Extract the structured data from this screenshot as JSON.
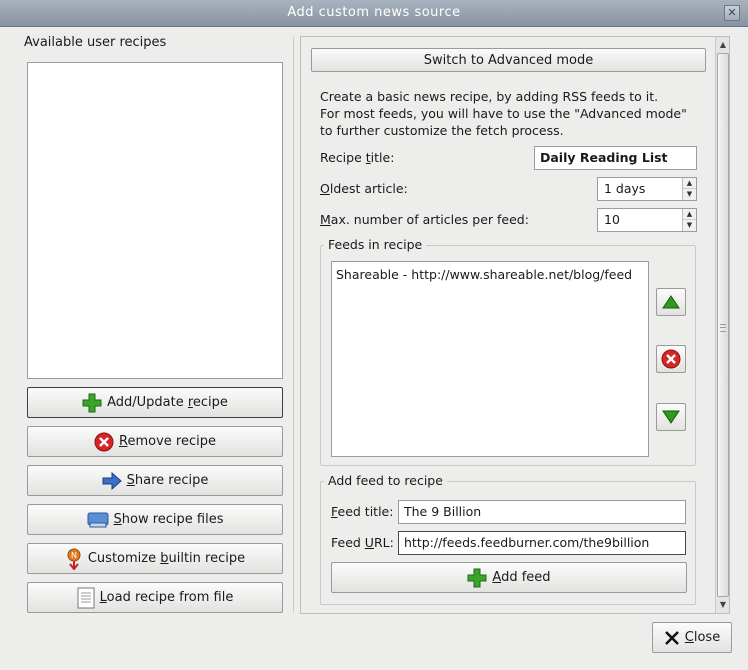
{
  "window": {
    "title": "Add custom news source",
    "close_glyph": "✕"
  },
  "left": {
    "group_label": "Available user recipes",
    "buttons": [
      {
        "icon": "plus-icon",
        "pre": "Add/Update ",
        "ul": "r",
        "post": "ecipe"
      },
      {
        "icon": "remove-icon",
        "pre": "",
        "ul": "R",
        "post": "emove recipe"
      },
      {
        "icon": "arrow-right-icon",
        "pre": "",
        "ul": "S",
        "post": "hare recipe"
      },
      {
        "icon": "folder-icon",
        "pre": "",
        "ul": "S",
        "post": "how recipe files"
      },
      {
        "icon": "customize-icon",
        "pre": "Customize ",
        "ul": "b",
        "post": "uiltin recipe"
      },
      {
        "icon": "document-icon",
        "pre": "",
        "ul": "L",
        "post": "oad recipe from file"
      }
    ]
  },
  "right": {
    "advanced_button": "Switch to Advanced mode",
    "info_lines": [
      "Create a basic news recipe, by adding RSS feeds to it.",
      "For most feeds, you will have to use the \"Advanced mode\"",
      "to further customize the fetch process."
    ],
    "recipe_title_label_pre": "Recipe ",
    "recipe_title_label_ul": "t",
    "recipe_title_label_post": "itle:",
    "recipe_title_value": "Daily Reading List",
    "oldest_label_ul": "O",
    "oldest_label_post": "ldest article:",
    "oldest_value": "1 days",
    "max_label_ul": "M",
    "max_label_post": "ax. number of articles per feed:",
    "max_value": "10",
    "feeds_group_label": "Feeds in recipe",
    "feeds": [
      "Shareable - http://www.shareable.net/blog/feed"
    ],
    "add_group_label": "Add feed to recipe",
    "feed_title_label_ul": "F",
    "feed_title_label_post": "eed title:",
    "feed_title_value": "The 9 Billion",
    "feed_url_label_pre": "Feed ",
    "feed_url_label_ul": "U",
    "feed_url_label_post": "RL:",
    "feed_url_value": "http://feeds.feedburner.com/the9billion",
    "add_feed_ul": "A",
    "add_feed_post": "dd feed"
  },
  "footer": {
    "close_ul": "C",
    "close_post": "lose"
  },
  "colors": {
    "green": "#2f9a1e",
    "red": "#d42626",
    "blue": "#2f5fb8"
  },
  "spin_up": "▲",
  "spin_down": "▼"
}
